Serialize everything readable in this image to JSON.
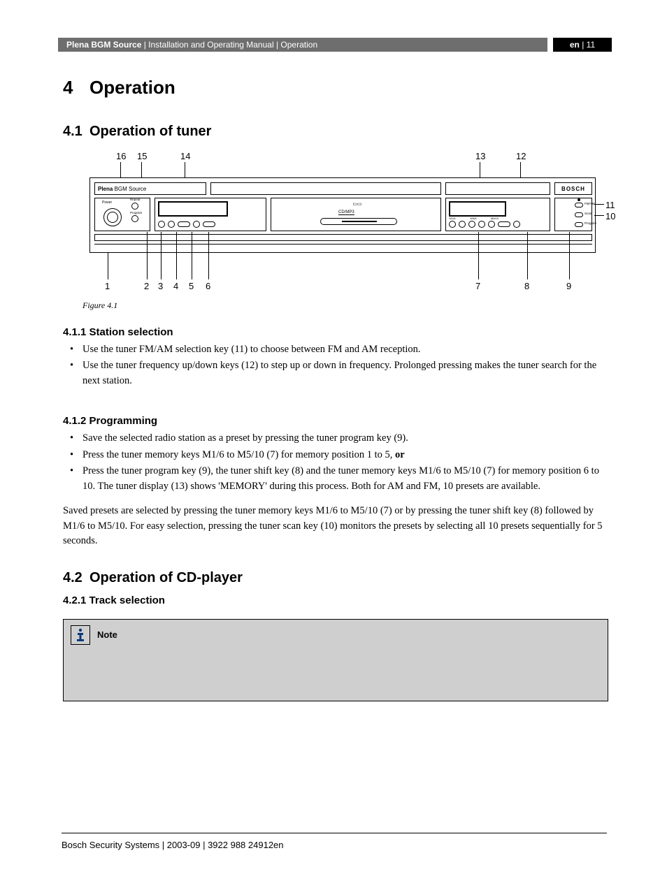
{
  "header": {
    "product": "Plena BGM Source",
    "separator": " | ",
    "doc": "Installation and Operating Manual",
    "section": "Operation",
    "lang": "en",
    "page": "11"
  },
  "chapter": {
    "num": "4",
    "title": "Operation"
  },
  "sec41": {
    "num": "4.1",
    "title": "Operation of tuner"
  },
  "figure": {
    "caption": "Figure 4.1",
    "labels": {
      "plena": "Plena",
      "bgm": "BGM S",
      "ource": "ource",
      "bosch": "BOSCH",
      "power": "Power",
      "repeat": "Repeat",
      "program": "Program",
      "cdmp3": "CD/MP3",
      "m16": "M1/6",
      "m38": "M3/8",
      "m510": "M5/10",
      "fmam": "FM/AM",
      "scan": "Scan",
      "prog": "Program"
    },
    "callouts_top": [
      "16",
      "15",
      "14",
      "13",
      "12"
    ],
    "callouts_right": [
      "11",
      "10"
    ],
    "callouts_bottom": [
      "1",
      "2",
      "3",
      "4",
      "5",
      "6",
      "7",
      "8",
      "9"
    ]
  },
  "sub411": {
    "num": "4.1.1",
    "title": "Station selection",
    "items": [
      "Use the tuner FM/AM selection key (11) to choose between FM and AM reception.",
      "Use the tuner frequency up/down keys (12) to step up or down in frequency. Prolonged pressing makes the tuner search for the next station."
    ]
  },
  "sub412": {
    "num": "4.1.2",
    "title": "Programming",
    "items": [
      "Save the selected radio station as a preset by pressing the tuner program key (9).",
      "Press the tuner memory keys M1/6 to M5/10 (7) for memory position 1 to 5, ",
      "Press the tuner program key (9), the tuner shift key (8) and the tuner memory keys M1/6 to M5/10 (7) for memory position 6 to 10. The tuner display (13) shows 'MEMORY' during this process. Both for AM and FM, 10 presets are available."
    ],
    "or": "or",
    "after": "Saved presets are selected by pressing the tuner memory keys M1/6 to M5/10 (7) or by pressing the tuner shift key (8) followed by M1/6 to M5/10. For easy selection, pressing the tuner scan key (10) monitors the presets by selecting all 10 presets sequentially for 5 seconds."
  },
  "sec42": {
    "num": "4.2",
    "title": "Operation of CD-player"
  },
  "sub421": {
    "num": "4.2.1",
    "title": "Track selection"
  },
  "note": {
    "label": "Note"
  },
  "footer": "Bosch Security Systems | 2003-09 | 3922 988 24912en"
}
